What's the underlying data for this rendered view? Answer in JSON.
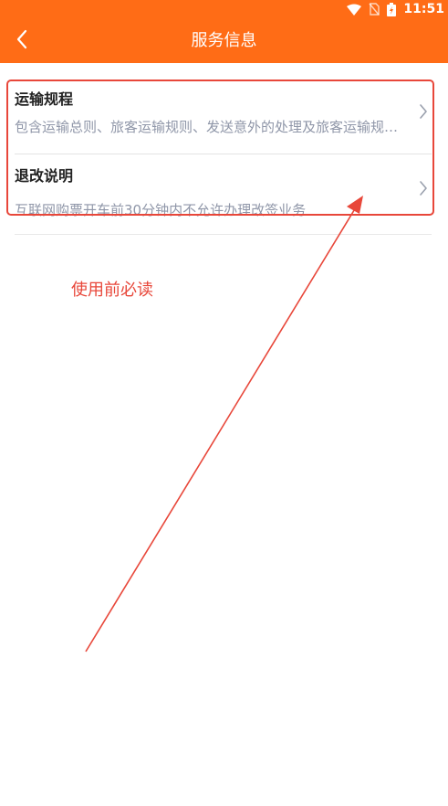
{
  "status_bar": {
    "time": "11:51",
    "icons": [
      "wifi-icon",
      "no-sim-icon",
      "battery-charging-icon"
    ]
  },
  "header": {
    "title": "服务信息",
    "back_icon": "chevron-left-icon"
  },
  "list": {
    "items": [
      {
        "title": "运输规程",
        "description": "包含运输总则、旅客运输规则、发送意外的处理及旅客运输规则等内容"
      },
      {
        "title": "退改说明",
        "description": "互联网购票开车前30分钟内不允许办理改签业务"
      }
    ]
  },
  "annotation": {
    "text": "使用前必读",
    "color": "#e8473a"
  },
  "colors": {
    "header_bg": "#ff6c16",
    "title_text": "#222222",
    "desc_text": "#8f96a8"
  }
}
